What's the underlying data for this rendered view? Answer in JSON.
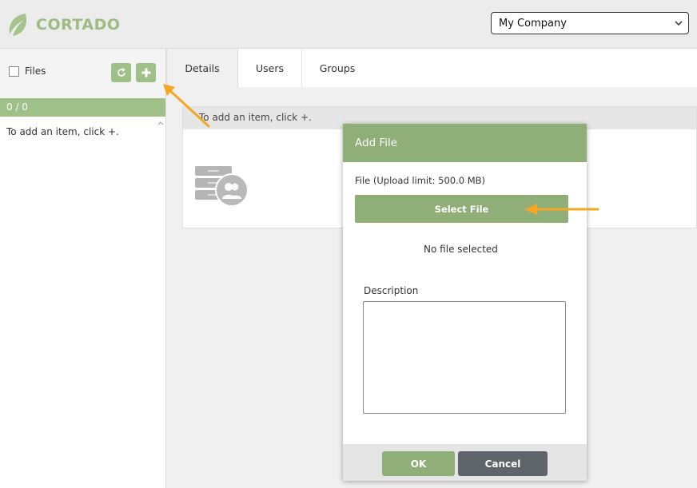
{
  "header": {
    "logo_text": "CORTADO",
    "company_select": {
      "value": "My Company"
    }
  },
  "sidebar": {
    "files_label": "Files",
    "count": "0 / 0",
    "empty_hint": "To add an item, click +."
  },
  "tabs": [
    {
      "label": "Details"
    },
    {
      "label": "Users"
    },
    {
      "label": "Groups"
    }
  ],
  "details": {
    "empty_hint": "To add an item, click +."
  },
  "dialog": {
    "title": "Add File",
    "upload_limit": "File (Upload limit: 500.0 MB)",
    "select_file_label": "Select File",
    "no_file_text": "No file selected",
    "description_label": "Description",
    "description_value": "",
    "ok_label": "OK",
    "cancel_label": "Cancel"
  },
  "colors": {
    "accent_green": "#8fae78",
    "annotation_orange": "#f5a623",
    "cancel_gray": "#5e646a"
  }
}
